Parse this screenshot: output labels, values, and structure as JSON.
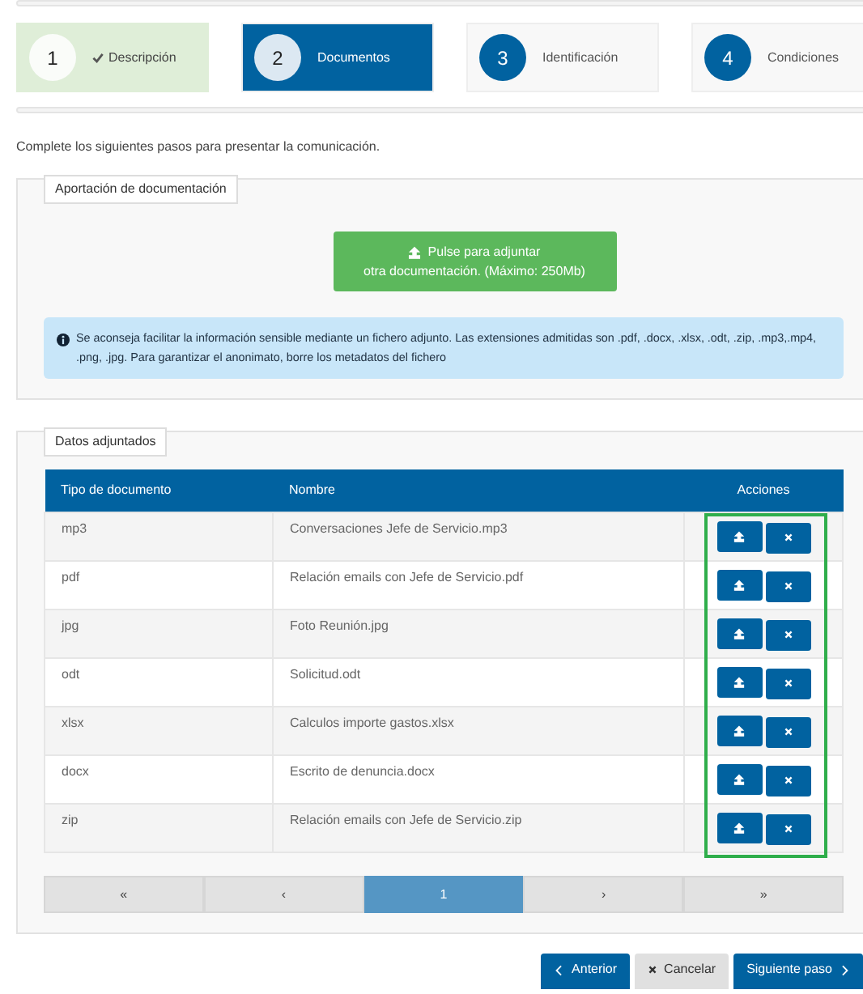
{
  "steps": [
    {
      "number": "1",
      "label": "Descripción",
      "completed": true,
      "selected": false
    },
    {
      "number": "2",
      "label": "Documentos",
      "completed": false,
      "selected": true
    },
    {
      "number": "3",
      "label": "Identificación",
      "completed": false,
      "selected": false
    },
    {
      "number": "4",
      "label": "Condiciones",
      "completed": false,
      "selected": false
    }
  ],
  "intro": "Complete los siguientes pasos para presentar la comunicación.",
  "upload_section": {
    "legend": "Aportación de documentación",
    "upload_button": [
      "Pulse para adjuntar",
      "otra documentación. (Máximo: 250Mb)"
    ],
    "info": "Se aconseja facilitar la información sensible mediante un fichero adjunto. Las extensiones admitidas son .pdf, .docx, .xlsx, .odt, .zip, .mp3,.mp4, .png, .jpg. Para garantizar el anonimato, borre los metadatos del fichero"
  },
  "attachments": {
    "legend": "Datos adjuntados",
    "columns": [
      "Tipo de documento",
      "Nombre",
      "Acciones"
    ],
    "actions_highlighted": true,
    "rows": [
      {
        "type": "mp3",
        "name": "Conversaciones Jefe de Servicio.mp3"
      },
      {
        "type": "pdf",
        "name": "Relación emails con Jefe de Servicio.pdf"
      },
      {
        "type": "jpg",
        "name": "Foto Reunión.jpg"
      },
      {
        "type": "odt",
        "name": "Solicitud.odt"
      },
      {
        "type": "xlsx",
        "name": "Calculos importe gastos.xlsx"
      },
      {
        "type": "docx",
        "name": "Escrito de denuncia.docx"
      },
      {
        "type": "zip",
        "name": "Relación emails con Jefe de Servicio.zip"
      }
    ],
    "pagination": [
      {
        "label": "«",
        "selected": false
      },
      {
        "label": "‹",
        "selected": false
      },
      {
        "label": "1",
        "selected": true
      },
      {
        "label": "›",
        "selected": false
      },
      {
        "label": "»",
        "selected": false
      }
    ]
  },
  "footer_buttons": [
    {
      "kind": "back",
      "label": "Anterior"
    },
    {
      "kind": "cancel",
      "label": "Cancelar"
    },
    {
      "kind": "next",
      "label": "Siguiente paso"
    }
  ]
}
